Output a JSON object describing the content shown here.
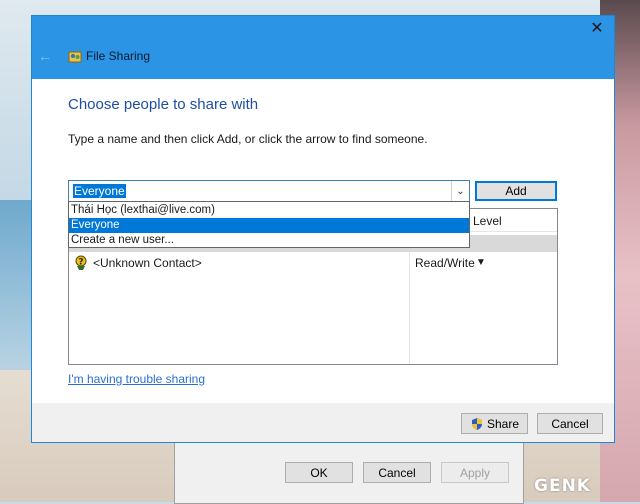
{
  "window": {
    "title": "File Sharing",
    "heading": "Choose people to share with",
    "instruction": "Type a name and then click Add, or click the arrow to find someone."
  },
  "combo": {
    "value": "Everyone",
    "options": [
      "Thái Học (lexthai@live.com)",
      "Everyone",
      "Create a new user..."
    ],
    "selected_index": 1
  },
  "buttons": {
    "add": "Add",
    "share": "Share",
    "cancel": "Cancel"
  },
  "list": {
    "header_permission_partial": "Level",
    "rows": [
      {
        "name": "<Unknown Contact>",
        "permission": "Read/Write",
        "icon": "unknown-contact-icon"
      }
    ]
  },
  "links": {
    "trouble": "I'm having trouble sharing"
  },
  "back_dialog": {
    "ok": "OK",
    "cancel": "Cancel",
    "apply": "Apply"
  },
  "watermark": "GENK",
  "colors": {
    "titlebar": "#2b94e4",
    "accent": "#0078d7",
    "heading": "#1f4ea5",
    "link": "#2a6fd0"
  }
}
